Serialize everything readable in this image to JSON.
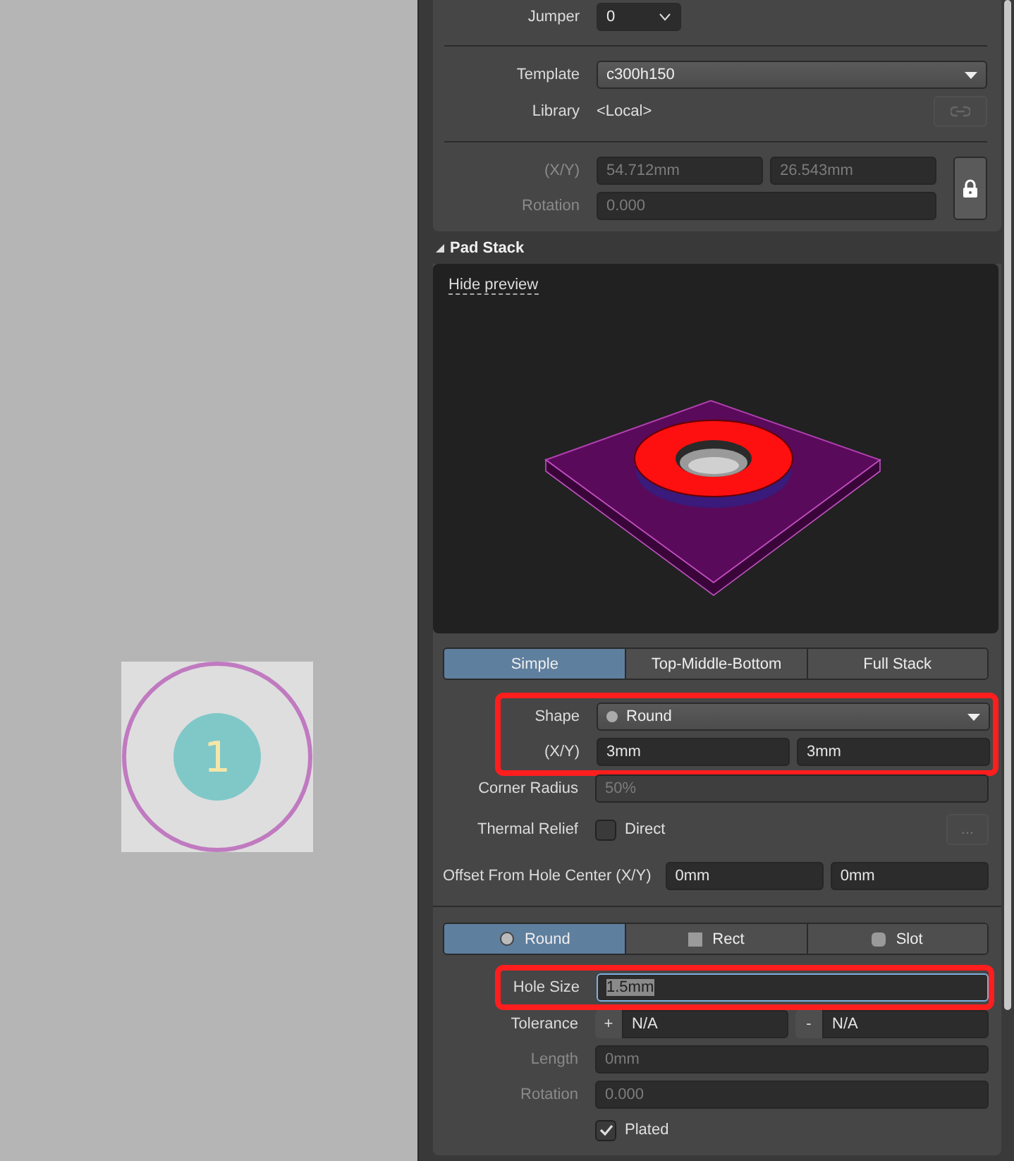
{
  "canvas": {
    "pad": {
      "designator": "1"
    }
  },
  "properties": {
    "jumper": {
      "label": "Jumper",
      "value": "0"
    },
    "template": {
      "label": "Template",
      "value": "c300h150"
    },
    "library": {
      "label": "Library",
      "value": "<Local>"
    },
    "location": {
      "label": "(X/Y)",
      "x": "54.712mm",
      "y": "26.543mm",
      "disabled": true,
      "locked": true
    },
    "rotation": {
      "label": "Rotation",
      "value": "0.000",
      "disabled": true
    }
  },
  "pad_stack": {
    "title": "Pad Stack",
    "expanded": true,
    "hide_preview": "Hide preview",
    "modes": [
      {
        "label": "Simple",
        "selected": true
      },
      {
        "label": "Top-Middle-Bottom",
        "selected": false
      },
      {
        "label": "Full Stack",
        "selected": false
      }
    ],
    "shape": {
      "label": "Shape",
      "value": "Round",
      "highlighted": true
    },
    "size": {
      "label": "(X/Y)",
      "x": "3mm",
      "y": "3mm"
    },
    "corner_radius": {
      "label": "Corner Radius",
      "value": "50%",
      "disabled": true
    },
    "thermal_relief": {
      "label": "Thermal Relief",
      "option": "Direct",
      "checked": false,
      "more": "..."
    },
    "offset": {
      "label": "Offset From Hole Center (X/Y)",
      "x": "0mm",
      "y": "0mm"
    }
  },
  "hole": {
    "types": [
      {
        "label": "Round",
        "kind": "round",
        "selected": true
      },
      {
        "label": "Rect",
        "kind": "rect",
        "selected": false
      },
      {
        "label": "Slot",
        "kind": "slot",
        "selected": false
      }
    ],
    "size": {
      "label": "Hole Size",
      "value": "1.5mm",
      "highlighted": true,
      "text_selected": true
    },
    "tolerance": {
      "label": "Tolerance",
      "plus": "+",
      "plus_value": "N/A",
      "minus": "-",
      "minus_value": "N/A"
    },
    "length": {
      "label": "Length",
      "value": "0mm",
      "disabled": true
    },
    "rotation": {
      "label": "Rotation",
      "value": "0.000",
      "disabled": true
    },
    "plated": {
      "label": "Plated",
      "checked": true
    }
  }
}
